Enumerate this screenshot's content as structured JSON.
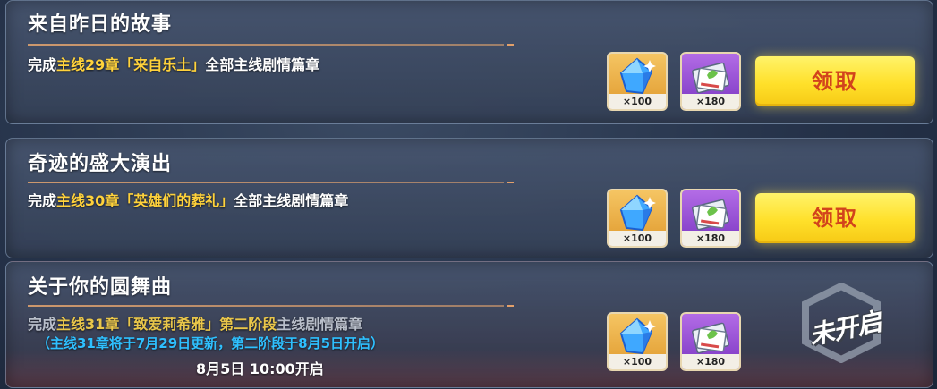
{
  "quests": [
    {
      "title": "来自昨日的故事",
      "desc_pre": "完成",
      "desc_hl": "主线29章「来自乐土」",
      "desc_post": "全部主线剧情篇章",
      "rewards": [
        {
          "icon": "crystal-icon",
          "qty": "×100"
        },
        {
          "icon": "ticket-icon",
          "qty": "×180"
        }
      ],
      "button": "领取"
    },
    {
      "title": "奇迹的盛大演出",
      "desc_pre": "完成",
      "desc_hl": "主线30章「英雄们的葬礼」",
      "desc_post": "全部主线剧情篇章",
      "rewards": [
        {
          "icon": "crystal-icon",
          "qty": "×100"
        },
        {
          "icon": "ticket-icon",
          "qty": "×180"
        }
      ],
      "button": "领取"
    },
    {
      "title": "关于你的圆舞曲",
      "desc_pre": "完成",
      "desc_hl": "主线31章「致爱莉希雅」第二阶段",
      "desc_post": "主线剧情篇章",
      "note": "（主线31章将于7月29日更新，第二阶段于8月5日开启）",
      "open_time": "8月5日 10:00开启",
      "rewards": [
        {
          "icon": "crystal-icon",
          "qty": "×100"
        },
        {
          "icon": "ticket-icon",
          "qty": "×180"
        }
      ],
      "status": "未开启"
    }
  ]
}
